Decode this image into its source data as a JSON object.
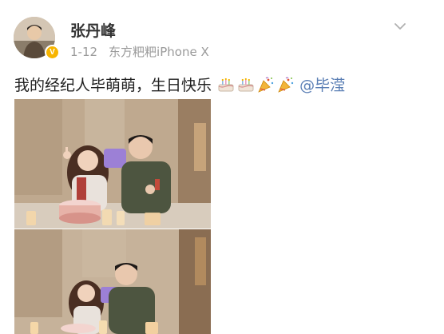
{
  "post": {
    "author": {
      "name": "张丹峰",
      "verified_badge": "V"
    },
    "meta": {
      "date": "1-12",
      "source": "东方粑粑iPhone X"
    },
    "text": "我的经纪人毕萌萌，生日快乐",
    "emojis": [
      "cake-icon",
      "cake-icon",
      "party-popper-icon",
      "party-popper-icon"
    ],
    "mention": "@毕滢"
  },
  "colors": {
    "mention": "#5b7fb5",
    "meta": "#9a9a9a",
    "badge": "#f7b500"
  }
}
